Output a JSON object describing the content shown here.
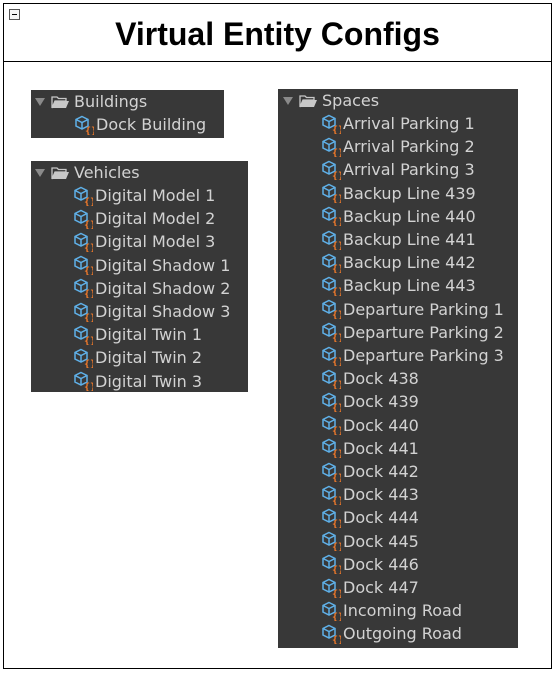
{
  "title": "Virtual Entity Configs",
  "icons": {
    "collapse": "minus-box-icon",
    "expand": "triangle-down-icon",
    "folder": "folder-open-icon",
    "entity": "cube-config-icon"
  },
  "colors": {
    "panel_bg": "#383838",
    "text": "#d2d2d2",
    "cube": "#5fb0e8",
    "braces": "#f07a2a"
  },
  "buildings": {
    "label": "Buildings",
    "items": [
      "Dock Building"
    ]
  },
  "vehicles": {
    "label": "Vehicles",
    "items": [
      "Digital Model 1",
      "Digital Model 2",
      "Digital Model 3",
      "Digital Shadow 1",
      "Digital Shadow 2",
      "Digital Shadow 3",
      "Digital Twin 1",
      "Digital Twin 2",
      "Digital Twin 3"
    ]
  },
  "spaces": {
    "label": "Spaces",
    "items": [
      "Arrival Parking 1",
      "Arrival Parking 2",
      "Arrival Parking 3",
      "Backup Line 439",
      "Backup Line 440",
      "Backup Line 441",
      "Backup Line 442",
      "Backup Line 443",
      "Departure Parking 1",
      "Departure Parking 2",
      "Departure Parking 3",
      "Dock 438",
      "Dock 439",
      "Dock 440",
      "Dock 441",
      "Dock 442",
      "Dock 443",
      "Dock 444",
      "Dock 445",
      "Dock 446",
      "Dock 447",
      "Incoming Road",
      "Outgoing Road"
    ]
  }
}
